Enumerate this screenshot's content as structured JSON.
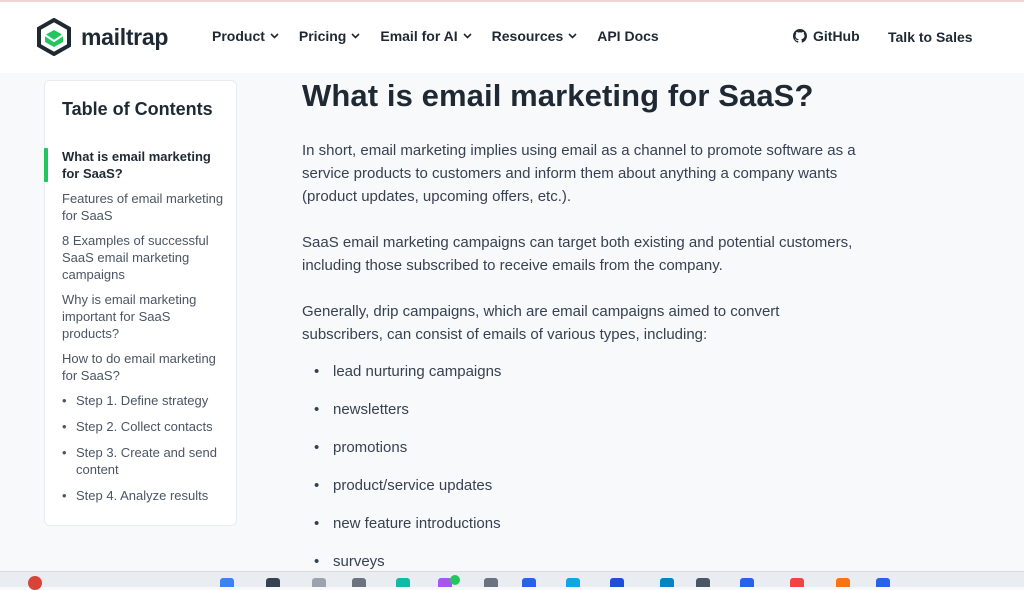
{
  "brand": {
    "name": "mailtrap",
    "color": "#22c55e",
    "dark": "#1f2933"
  },
  "nav": [
    {
      "label": "Product",
      "dropdown": true
    },
    {
      "label": "Pricing",
      "dropdown": true
    },
    {
      "label": "Email for AI",
      "dropdown": true
    },
    {
      "label": "Resources",
      "dropdown": true
    },
    {
      "label": "API Docs",
      "dropdown": false
    }
  ],
  "header_right": {
    "github": "GitHub",
    "sales": "Talk to Sales"
  },
  "toc": {
    "title": "Table of Contents",
    "items": [
      "What is email marketing for SaaS?",
      "Features of email marketing for SaaS",
      "8 Examples of successful SaaS email marketing campaigns",
      "Why is email marketing important for SaaS products?",
      "How to do email marketing for SaaS?"
    ],
    "subitems": [
      "Step 1. Define strategy",
      "Step 2. Collect contacts",
      "Step 3. Create and send content",
      "Step 4. Analyze results"
    ]
  },
  "article": {
    "heading": "What is email marketing for SaaS?",
    "p1": "In short, email marketing implies using email as a channel to promote software as a service products to customers and inform them about anything a company wants (product updates,  upcoming offers, etc.).",
    "p2": "SaaS email marketing campaigns can target both existing and potential customers, including those subscribed to receive emails from the company.",
    "p3": "Generally, drip campaigns, which are email campaigns aimed to convert subscribers, can consist of emails of various types, including:",
    "bullets": [
      "lead nurturing campaigns",
      "newsletters",
      "promotions",
      "product/service updates",
      "new feature introductions",
      "surveys"
    ]
  }
}
